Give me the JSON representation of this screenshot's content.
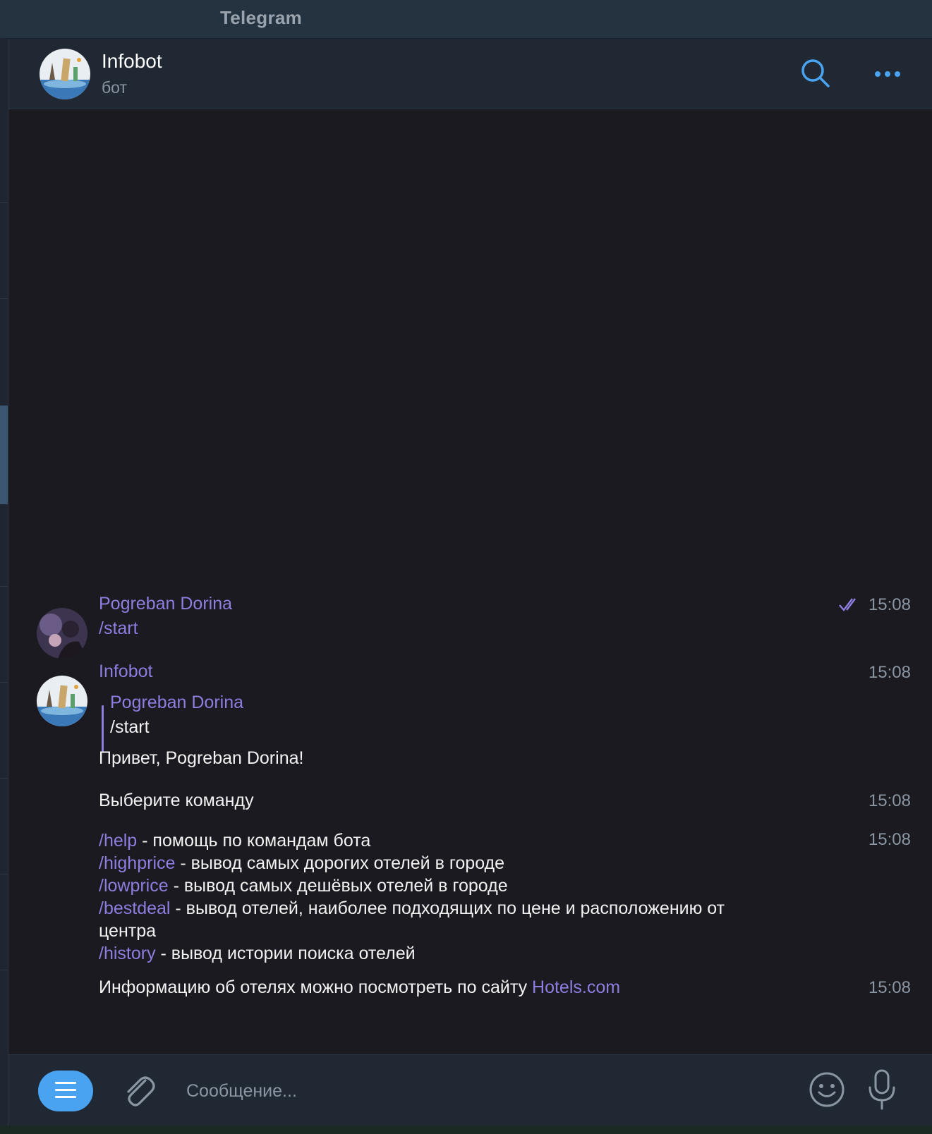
{
  "window": {
    "title": "Telegram"
  },
  "header": {
    "name": "Infobot",
    "status": "бот"
  },
  "messages": [
    {
      "sender": "Pogreban Dorina",
      "text": "/start",
      "time": "15:08",
      "read": true
    },
    {
      "sender": "Infobot",
      "time": "15:08",
      "reply": {
        "sender": "Pogreban Dorina",
        "text": "/start"
      },
      "text": "Привет, Pogreban Dorina!"
    },
    {
      "text": "Выберите команду",
      "time": "15:08"
    },
    {
      "time": "15:08",
      "commands": [
        {
          "cmd": "/help",
          "desc": " - помощь по командам бота"
        },
        {
          "cmd": "/highprice",
          "desc": " - вывод самых дорогих отелей в городе"
        },
        {
          "cmd": "/lowprice",
          "desc": " - вывод самых дешёвых отелей в городе"
        },
        {
          "cmd": "/bestdeal",
          "desc": " - вывод отелей, наиболее подходящих по цене и расположению от"
        },
        {
          "cmd": "",
          "desc": "центра"
        },
        {
          "cmd": "/history",
          "desc": " - вывод истории поиска отелей"
        }
      ]
    },
    {
      "text": "Информацию об отелях можно посмотреть по сайту ",
      "link": "Hotels.com",
      "time": "15:08"
    }
  ],
  "input": {
    "placeholder": "Сообщение..."
  },
  "icons": {
    "search": "search-icon",
    "more": "more-icon",
    "menu": "menu-icon",
    "attach": "paperclip-icon",
    "emoji": "smiley-icon",
    "mic": "microphone-icon",
    "read": "double-check-icon"
  },
  "colors": {
    "accent": "#8f7de0",
    "button": "#4aa3f0",
    "background": "#1a1a20",
    "header": "#1f2833"
  }
}
